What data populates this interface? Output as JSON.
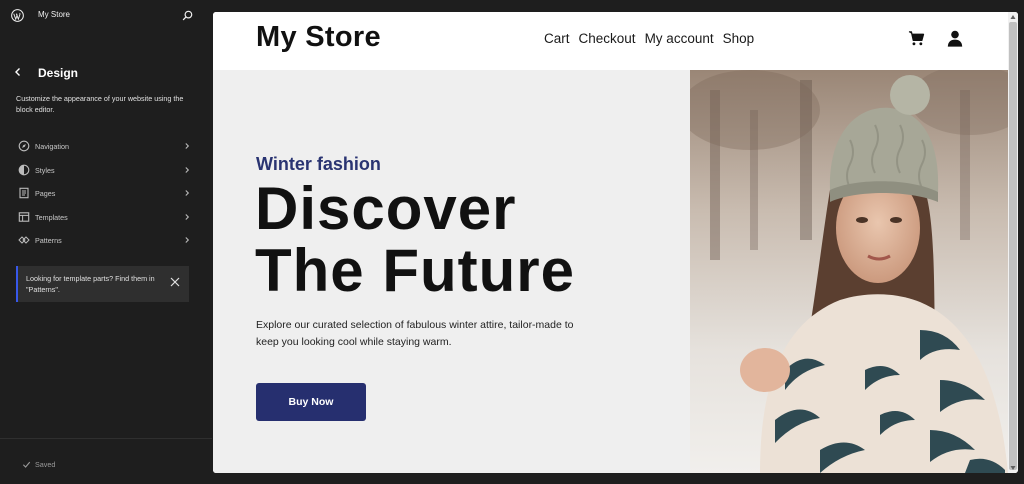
{
  "sidebar": {
    "site_title": "My Store",
    "design": {
      "title": "Design",
      "description": "Customize the appearance of your website using the block editor."
    },
    "items": [
      {
        "label": "Navigation",
        "icon": "navigation-icon"
      },
      {
        "label": "Styles",
        "icon": "styles-icon"
      },
      {
        "label": "Pages",
        "icon": "pages-icon"
      },
      {
        "label": "Templates",
        "icon": "templates-icon"
      },
      {
        "label": "Patterns",
        "icon": "patterns-icon"
      }
    ],
    "notice": {
      "text": "Looking for template parts? Find them in \"Patterns\"."
    },
    "saved_label": "Saved"
  },
  "preview": {
    "store_title": "My Store",
    "nav": [
      "Cart",
      "Checkout",
      "My account",
      "Shop"
    ],
    "hero": {
      "eyebrow": "Winter fashion",
      "headline_line1": "Discover",
      "headline_line2": "The Future",
      "subtext": "Explore our curated selection of fabulous winter attire, tailor-made to keep you looking cool while staying warm.",
      "button_label": "Buy Now"
    }
  },
  "colors": {
    "sidebar_bg": "#1e1e1e",
    "accent": "#3858e9",
    "eyebrow": "#2a3472",
    "button_bg": "#262f6f",
    "hero_bg": "#efefef"
  }
}
